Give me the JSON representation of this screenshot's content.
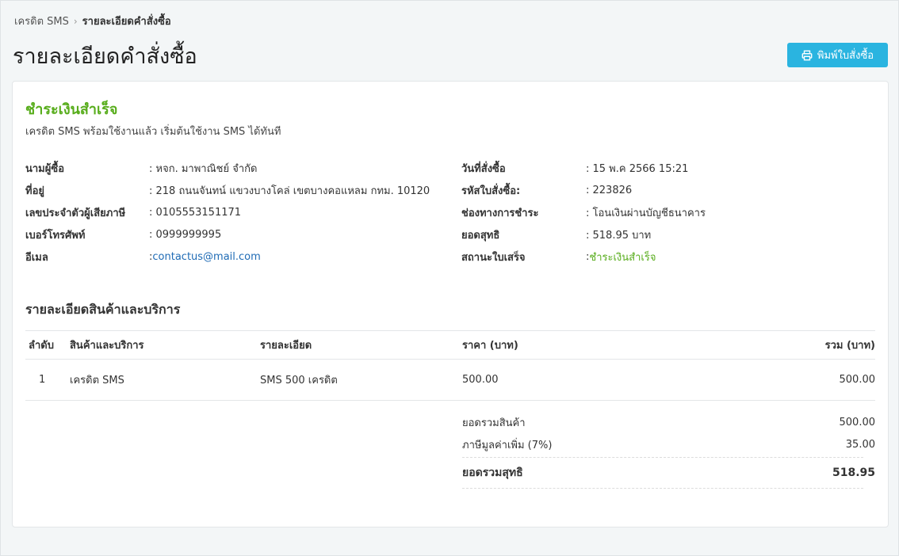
{
  "breadcrumb": {
    "parent": "เครดิต SMS",
    "current": "รายละเอียดคำสั่งซื้อ"
  },
  "page_title": "รายละเอียดคำสั่งซื้อ",
  "print_button": {
    "label": "พิมพ์ใบสั่งซื้อ",
    "icon": "printer-icon"
  },
  "status": {
    "title": "ชำระเงินสำเร็จ",
    "description": "เครดิต SMS พร้อมใช้งานแล้ว เริ่มต้นใช้งาน SMS ได้ทันที",
    "color": "#58ad1c"
  },
  "buyer_info": [
    {
      "label": "นามผู้ซื้อ",
      "value": ": หจก. มาพาณิชย์ จำกัด"
    },
    {
      "label": "ที่อยู่",
      "value": ": 218 ถนนจันทน์ แขวงบางโคล่ เขตบางคอแหลม กทม. 10120"
    },
    {
      "label": "เลขประจำตัวผู้เสียภาษี",
      "value": ": 0105553151171"
    },
    {
      "label": "เบอร์โทรศัพท์",
      "value": ": 0999999995"
    },
    {
      "label": "อีเมล",
      "value_prefix": ": ",
      "value": "contactus@mail.com"
    }
  ],
  "order_info": [
    {
      "label": "วันที่สั่งซื้อ",
      "value": ": 15 พ.ค 2566 15:21"
    },
    {
      "label": "รหัสใบสั่งซื้อ:",
      "value": ": 223826"
    },
    {
      "label": "ช่องทางการชำระ",
      "value": ": โอนเงินผ่านบัญชีธนาคาร"
    },
    {
      "label": "ยอดสุทธิ",
      "value": ": 518.95 บาท"
    },
    {
      "label": "สถานะใบเสร็จ",
      "value_prefix": ": ",
      "value": "ชำระเงินสำเร็จ"
    }
  ],
  "items_section_title": "รายละเอียดสินค้าและบริการ",
  "table": {
    "headers": [
      "ลำดับ",
      "สินค้าและบริการ",
      "รายละเอียด",
      "ราคา (บาท)",
      "รวม (บาท)"
    ],
    "rows": [
      [
        "1",
        "เครดิต SMS",
        "SMS 500 เครดิต",
        "500.00",
        "500.00"
      ]
    ]
  },
  "summary": {
    "subtotal_label": "ยอดรวมสินค้า",
    "subtotal_value": "500.00",
    "vat_label": "ภาษีมูลค่าเพิ่ม (7%)",
    "vat_value": "35.00",
    "net_label": "ยอดรวมสุทธิ",
    "net_value": "518.95"
  },
  "colors": {
    "accent": "#2ab4e0",
    "success": "#58ad1c",
    "link": "#1f6bb5"
  }
}
